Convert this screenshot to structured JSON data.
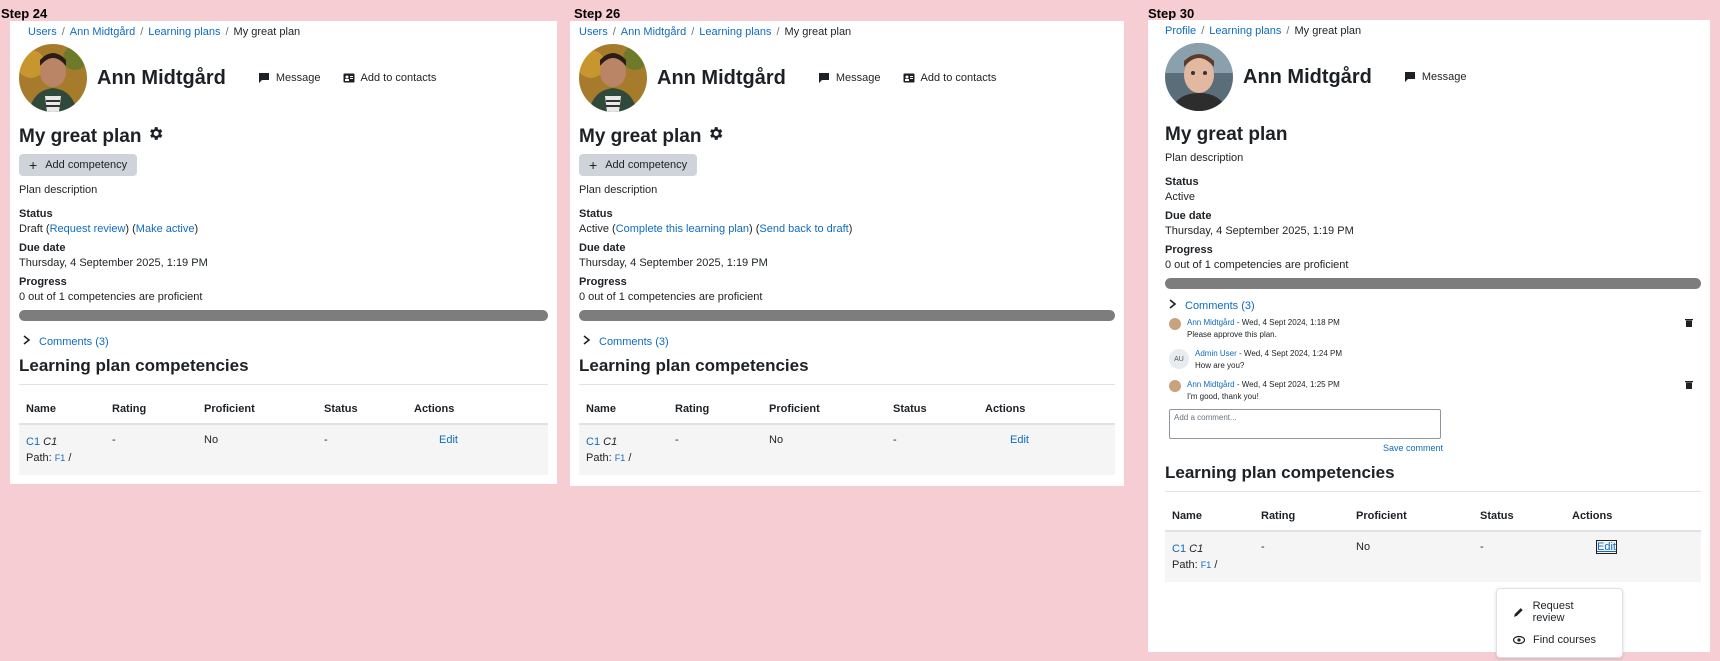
{
  "steps": [
    {
      "label": "Step 24",
      "breadcrumbs": [
        "Users",
        "Ann Midtgård",
        "Learning plans",
        "My great plan"
      ],
      "user_name": "Ann Midtgård",
      "actions": [
        "Message",
        "Add to contacts"
      ],
      "plan_title": "My great plan",
      "add_competency": "Add competency",
      "description": "Plan description",
      "status_label": "Status",
      "status_value": "Draft",
      "status_links": [
        "Request review",
        "Make active"
      ],
      "due_label": "Due date",
      "due_value": "Thursday, 4 September 2025, 1:19 PM",
      "progress_label": "Progress",
      "progress_text": "0 out of 1 competencies are proficient",
      "progress_fraction": 0,
      "comments_toggle": "Comments (3)",
      "section_title": "Learning plan competencies",
      "table": {
        "headers": [
          "Name",
          "Rating",
          "Proficient",
          "Status",
          "Actions"
        ],
        "row": {
          "name_link": "C1",
          "name_italic": "C1",
          "path_label": "Path:",
          "path_link": "F1",
          "path_sep": "/",
          "rating": "-",
          "proficient": "No",
          "status": "-",
          "action": "Edit"
        }
      }
    },
    {
      "label": "Step 26",
      "breadcrumbs": [
        "Users",
        "Ann Midtgård",
        "Learning plans",
        "My great plan"
      ],
      "user_name": "Ann Midtgård",
      "actions": [
        "Message",
        "Add to contacts"
      ],
      "plan_title": "My great plan",
      "add_competency": "Add competency",
      "description": "Plan description",
      "status_label": "Status",
      "status_value": "Active",
      "status_links": [
        "Complete this learning plan",
        "Send back to draft"
      ],
      "due_label": "Due date",
      "due_value": "Thursday, 4 September 2025, 1:19 PM",
      "progress_label": "Progress",
      "progress_text": "0 out of 1 competencies are proficient",
      "progress_fraction": 0,
      "comments_toggle": "Comments (3)",
      "section_title": "Learning plan competencies",
      "table": {
        "headers": [
          "Name",
          "Rating",
          "Proficient",
          "Status",
          "Actions"
        ],
        "row": {
          "name_link": "C1",
          "name_italic": "C1",
          "path_label": "Path:",
          "path_link": "F1",
          "path_sep": "/",
          "rating": "-",
          "proficient": "No",
          "status": "-",
          "action": "Edit"
        }
      }
    },
    {
      "label": "Step 30",
      "breadcrumbs": [
        "Profile",
        "Learning plans",
        "My great plan"
      ],
      "user_name": "Ann Midtgård",
      "actions": [
        "Message"
      ],
      "plan_title": "My great plan",
      "description": "Plan description",
      "status_label": "Status",
      "status_value": "Active",
      "due_label": "Due date",
      "due_value": "Thursday, 4 September 2025, 1:19 PM",
      "progress_label": "Progress",
      "progress_text": "0 out of 1 competencies are proficient",
      "progress_fraction": 0,
      "comments_toggle": "Comments (3)",
      "comments": [
        {
          "author": "Ann Midtgård",
          "meta": " - Wed, 4 Sept 2024, 1:18 PM",
          "text": "Please approve this plan."
        },
        {
          "author": "Admin User",
          "initials": "AU",
          "meta": " - Wed, 4 Sept 2024, 1:24 PM",
          "text": "How are you?"
        },
        {
          "author": "Ann Midtgård",
          "meta": " - Wed, 4 Sept 2024, 1:25 PM",
          "text": "I'm good, thank you!"
        }
      ],
      "comment_placeholder": "Add a comment...",
      "save_comment": "Save comment",
      "section_title": "Learning plan competencies",
      "table": {
        "headers": [
          "Name",
          "Rating",
          "Proficient",
          "Status",
          "Actions"
        ],
        "row": {
          "name_link": "C1",
          "name_italic": "C1",
          "path_label": "Path:",
          "path_link": "F1",
          "path_sep": "/",
          "rating": "-",
          "proficient": "No",
          "status": "-",
          "action": "Edit"
        }
      },
      "menu": [
        "Request review",
        "Find courses"
      ]
    }
  ]
}
